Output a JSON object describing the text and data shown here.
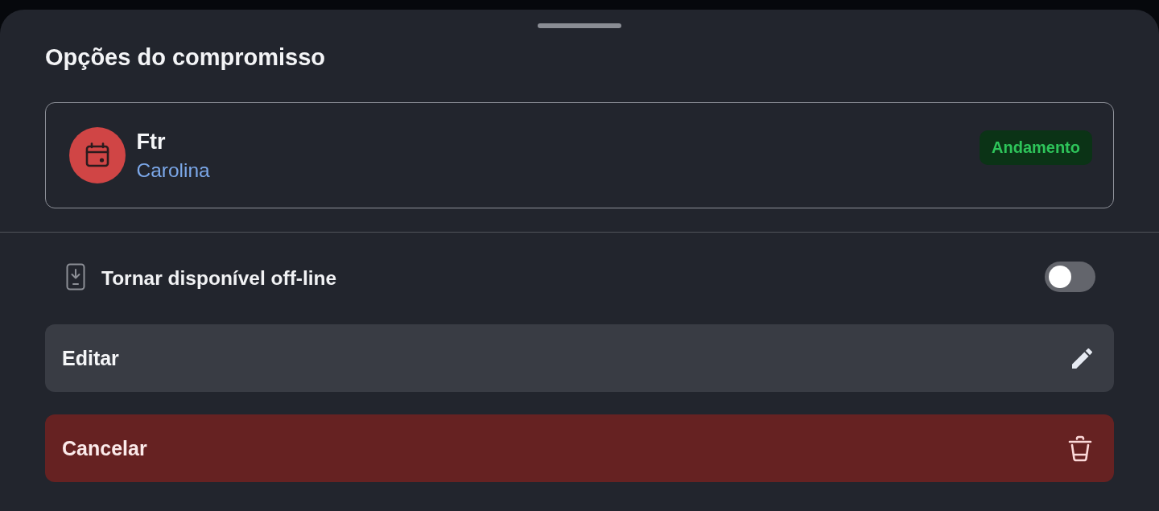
{
  "sheet": {
    "title": "Opções do compromisso"
  },
  "appointment": {
    "title": "Ftr",
    "person": "Carolina",
    "status": "Andamento"
  },
  "options": [
    {
      "kind": "toggle",
      "label": "Tornar disponível off-line",
      "on": false
    },
    {
      "kind": "edit",
      "label": "Editar"
    },
    {
      "kind": "delete",
      "label": "Cancelar"
    }
  ]
}
